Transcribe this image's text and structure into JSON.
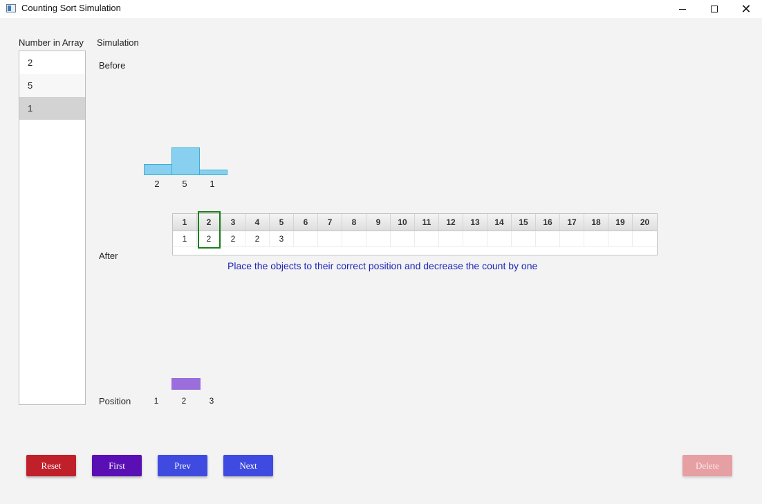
{
  "window": {
    "title": "Counting Sort Simulation"
  },
  "labels": {
    "number_in_array": "Number in Array",
    "simulation": "Simulation",
    "before": "Before",
    "after": "After",
    "position": "Position"
  },
  "array_list": [
    "2",
    "5",
    "1"
  ],
  "selected_index": 2,
  "histogram": {
    "values": [
      2,
      5,
      1
    ],
    "labels": [
      "2",
      "5",
      "1"
    ],
    "color": "#89cff0"
  },
  "count_table": {
    "headers": [
      "1",
      "2",
      "3",
      "4",
      "5",
      "6",
      "7",
      "8",
      "9",
      "10",
      "11",
      "12",
      "13",
      "14",
      "15",
      "16",
      "17",
      "18",
      "19",
      "20"
    ],
    "values": [
      "1",
      "2",
      "2",
      "2",
      "3",
      "",
      "",
      "",
      "",
      "",
      "",
      "",
      "",
      "",
      "",
      "",
      "",
      "",
      "",
      ""
    ],
    "highlight_index": 1,
    "highlight_color": "#1a7f1a"
  },
  "message": "Place the objects to their correct position and decrease the count by one",
  "positions": {
    "labels": [
      "1",
      "2",
      "3"
    ],
    "placed_color": "#9a6fdb"
  },
  "buttons": {
    "reset": "Reset",
    "first": "First",
    "prev": "Prev",
    "next": "Next",
    "delete": "Delete"
  },
  "icons": {
    "minimize": "minimize-icon",
    "maximize": "maximize-icon",
    "close": "close-icon"
  }
}
